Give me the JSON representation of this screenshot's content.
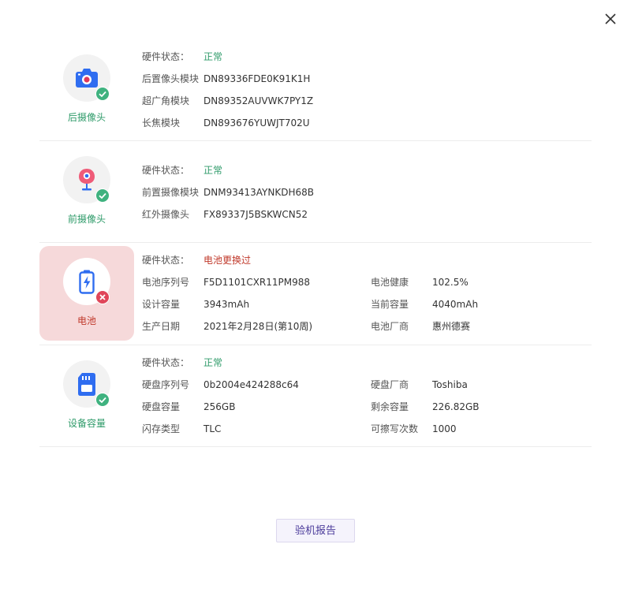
{
  "dialog": {
    "close_icon": "close-icon",
    "report_button": "验机报告"
  },
  "colors": {
    "ok": "#2f9b6a",
    "error": "#c0392b",
    "error_tile_bg": "#f6d9da",
    "accent": "#4a3a9a"
  },
  "rear_camera": {
    "label": "后摄像头",
    "icon": "camera-icon",
    "status_icon": "check-circle-icon",
    "rows": [
      {
        "label": "硬件状态：",
        "value": "正常"
      },
      {
        "label": "后置像头模块",
        "value": "DN89336FDE0K91K1H"
      },
      {
        "label": "超广角模块",
        "value": "DN89352AUVWK7PY1Z"
      },
      {
        "label": "长焦模块",
        "value": "DN893676YUWJT702U"
      }
    ]
  },
  "front_camera": {
    "label": "前摄像头",
    "icon": "webcam-icon",
    "status_icon": "check-circle-icon",
    "rows": [
      {
        "label": "硬件状态：",
        "value": "正常"
      },
      {
        "label": "前置摄像模块",
        "value": "DNM93413AYNKDH68B"
      },
      {
        "label": "红外摄像头",
        "value": "FX89337J5BSKWCN52"
      }
    ]
  },
  "battery": {
    "label": "电池",
    "icon": "battery-icon",
    "status_icon": "error-circle-icon",
    "status": {
      "label": "硬件状态：",
      "value": "电池更换过"
    },
    "rows": [
      {
        "label": "电池序列号",
        "value": "F5D1101CXR11PM988",
        "label2": "电池健康",
        "value2": "102.5%"
      },
      {
        "label": "设计容量",
        "value": "3943mAh",
        "label2": "当前容量",
        "value2": "4040mAh"
      },
      {
        "label": "生产日期",
        "value": "2021年2月28日(第10周)",
        "label2": "电池厂商",
        "value2": "惠州德赛"
      }
    ]
  },
  "storage": {
    "label": "设备容量",
    "icon": "sd-card-icon",
    "status_icon": "check-circle-icon",
    "status": {
      "label": "硬件状态：",
      "value": "正常"
    },
    "rows": [
      {
        "label": "硬盘序列号",
        "value": "0b2004e424288c64",
        "label2": "硬盘厂商",
        "value2": "Toshiba"
      },
      {
        "label": "硬盘容量",
        "value": "256GB",
        "label2": "剩余容量",
        "value2": "226.82GB"
      },
      {
        "label": "闪存类型",
        "value": "TLC",
        "label2": "可擦写次数",
        "value2": "1000"
      }
    ]
  }
}
